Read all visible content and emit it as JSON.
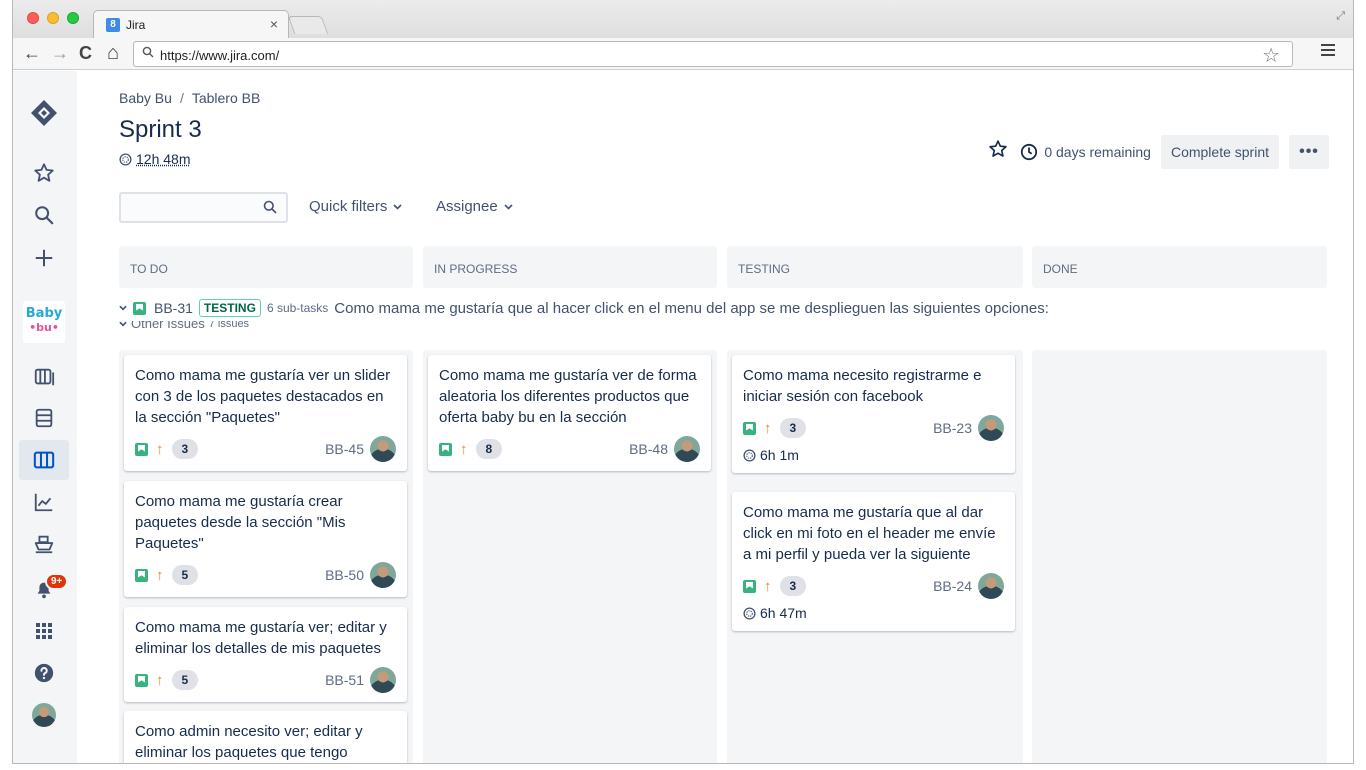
{
  "browser": {
    "tab_title": "Jira",
    "tab_close": "×",
    "url": "https://www.jira.com/",
    "back": "←",
    "forward": "→",
    "reload": "C",
    "home": "⌂",
    "star": "☆",
    "expand": "⤢"
  },
  "breadcrumb": {
    "project": "Baby Bu",
    "separator": "/",
    "board": "Tablero BB"
  },
  "sprint": {
    "title": "Sprint 3",
    "time_tracked": "12h 48m",
    "days_remaining": "0 days remaining",
    "complete_label": "Complete sprint",
    "more_label": "•••"
  },
  "filters": {
    "search_placeholder": "",
    "quick_filters": "Quick filters",
    "assignee": "Assignee"
  },
  "columns": [
    "TO DO",
    "IN PROGRESS",
    "TESTING",
    "DONE"
  ],
  "swimlane": {
    "key": "BB-31",
    "status": "TESTING",
    "subtasks": "6 sub-tasks",
    "summary": "Como mama me gustaría que al hacer click en el menu del app se me desplieguen las siguientes opciones:"
  },
  "other_issues": {
    "label": "Other Issues",
    "count": "7 issues"
  },
  "sidebar": {
    "logo_top": "Baby",
    "logo_bottom": "•bu•",
    "notification_count": "9+"
  },
  "colors": {
    "story": "#36b37e",
    "priority_high": "#ff7a1a",
    "status_border": "#57d9a3",
    "badge": "#de350b"
  },
  "cards": {
    "todo": [
      {
        "summary": "Como mama me gustaría ver un slider con 3 de los paquetes destacados en la sección \"Paquetes\"",
        "points": "3",
        "key": "BB-45"
      },
      {
        "summary": "Como mama me gustaría crear paquetes desde la sección \"Mis Paquetes\"",
        "points": "5",
        "key": "BB-50"
      },
      {
        "summary": "Como mama me gustaría ver; editar y eliminar los detalles de mis paquetes",
        "points": "5",
        "key": "BB-51"
      },
      {
        "summary": "Como admin necesito ver; editar y eliminar los paquetes que tengo"
      }
    ],
    "in_progress": [
      {
        "summary": "Como mama me gustaría ver de forma aleatoria los diferentes productos que oferta baby bu en la sección",
        "points": "8",
        "key": "BB-48"
      }
    ],
    "testing": [
      {
        "summary": "Como mama necesito registrarme e iniciar sesión con facebook",
        "points": "3",
        "key": "BB-23",
        "estimate": "6h 1m"
      },
      {
        "summary": "Como mama me gustaría que al dar click en mi foto en el header me envíe a mi perfil y pueda ver la siguiente",
        "points": "3",
        "key": "BB-24",
        "estimate": "6h 47m"
      }
    ]
  }
}
